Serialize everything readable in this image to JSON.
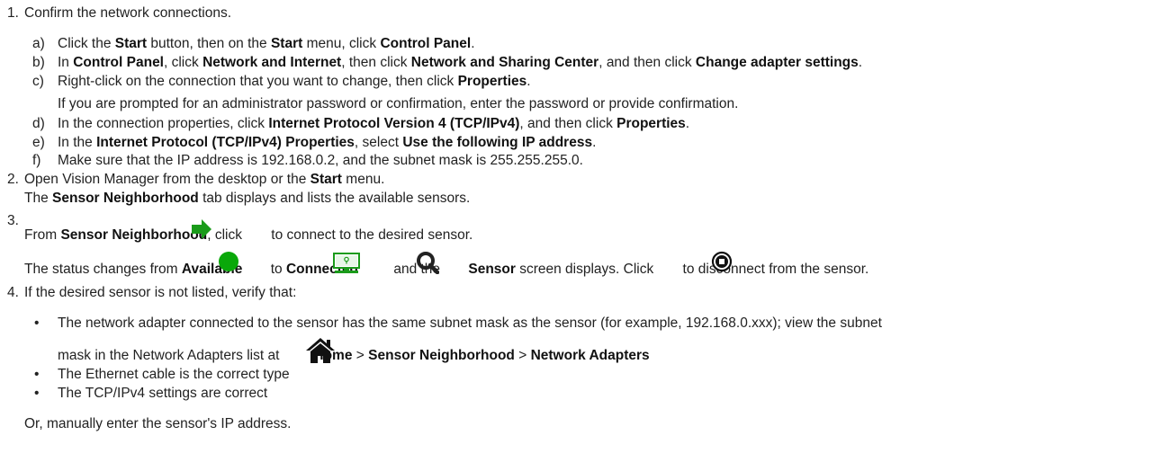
{
  "step1": {
    "num": "1.",
    "text": "Confirm the network connections.",
    "a": {
      "letter": "a)",
      "t1": "Click the ",
      "b1": "Start",
      "t2": " button, then on the ",
      "b2": "Start",
      "t3": " menu, click ",
      "b3": "Control Panel",
      "t4": "."
    },
    "b": {
      "letter": "b)",
      "t1": "In ",
      "b1": "Control Panel",
      "t2": ", click ",
      "b2": "Network and Internet",
      "t3": ", then click ",
      "b3": "Network and Sharing Center",
      "t4": ", and then click ",
      "b4": "Change adapter settings",
      "t5": "."
    },
    "c": {
      "letter": "c)",
      "t1": "Right-click on the connection that you want to change, then click ",
      "b1": "Properties",
      "t2": "."
    },
    "c_note": "If you are prompted for an administrator password or confirmation, enter the password or provide confirmation.",
    "d": {
      "letter": "d)",
      "t1": "In the connection properties, click ",
      "b1": "Internet Protocol Version 4 (TCP/IPv4)",
      "t2": ", and then click ",
      "b2": "Properties",
      "t3": "."
    },
    "e": {
      "letter": "e)",
      "t1": "In the ",
      "b1": "Internet Protocol (TCP/IPv4) Properties",
      "t2": ", select ",
      "b2": "Use the following IP address",
      "t3": "."
    },
    "f": {
      "letter": "f)",
      "t1": "Make sure that the IP address is 192.168.0.2, and the subnet mask is 255.255.255.0."
    }
  },
  "step2": {
    "num": "2.",
    "t1": "Open Vision Manager from the desktop or the ",
    "b1": "Start",
    "t2": " menu.",
    "l2_b1": "Sensor Neighborhood",
    "l2_t1": " tab displays and lists the available sensors.",
    "l2_t0": "The "
  },
  "step3": {
    "num": "3.",
    "t1": "From ",
    "b1": "Sensor Neighborhood",
    "t2": ", click",
    "t3": " to connect to the desired sensor.",
    "l2_t1": "The status changes from ",
    "l2_b1": "Available",
    "l2_t2": " to ",
    "l2_b2": "Connected",
    "l2_t3": " and the ",
    "l2_b3": "Sensor",
    "l2_t4": " screen displays. Click",
    "l2_t5": " to disconnect from the sensor."
  },
  "step4": {
    "num": "4.",
    "text": "If the desired sensor is not listed, verify that:",
    "bullet1_l1": "The network adapter connected to the sensor has the same subnet mask as the sensor (for example, 192.168.0.xxx); view the subnet",
    "bullet1_l2_t": "mask in the Network Adapters list at",
    "bullet1_l2_b1": "Home",
    "bullet1_l2_sep1": " > ",
    "bullet1_l2_b2": "Sensor Neighborhood",
    "bullet1_l2_sep2": " > ",
    "bullet1_l2_b3": "Network Adapters",
    "bullet2": "The Ethernet cable is the correct type",
    "bullet3": "The TCP/IPv4 settings are correct",
    "closing": "Or, manually enter the sensor's IP address.",
    "bullet_char": "•"
  },
  "icons": {
    "arrow": "arrow-right-icon",
    "available": "available-status-icon",
    "connected": "connected-monitor-icon",
    "sensor": "sensor-search-icon",
    "disconnect": "disconnect-stop-icon",
    "home": "home-icon"
  },
  "colors": {
    "green": "#00a000",
    "text": "#222222"
  }
}
